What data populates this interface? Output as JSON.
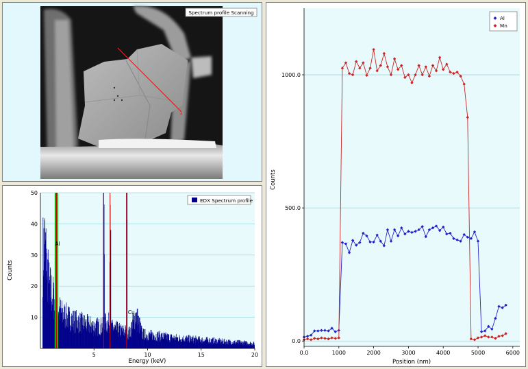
{
  "image_panel": {
    "legend_label": "Spectrum profile Scanning",
    "scan_marker": "1"
  },
  "edx_panel": {
    "legend_label": "EDX Spectrum profile",
    "colors": {
      "bars": "#00008b",
      "plot_bg": "#e8fafc",
      "al_band": "#22cc22",
      "al_line": "#cc0000",
      "mn_line": "#cc0000"
    }
  },
  "profile_panel": {
    "colors": {
      "al": "#2222cc",
      "mn": "#cc2222",
      "plot_bg": "#e8fafc",
      "grid": "#9ad6e0"
    }
  },
  "chart_data": [
    {
      "type": "bar",
      "title": "",
      "xlabel": "Energy (keV)",
      "ylabel": "Counts",
      "xlim": [
        0,
        20
      ],
      "ylim": [
        0,
        50
      ],
      "xticks": [
        5,
        10,
        15,
        20
      ],
      "yticks": [
        10,
        20,
        30,
        40,
        50
      ],
      "grid": true,
      "legend": "top-right",
      "series": [
        {
          "name": "EDX Spectrum profile"
        }
      ],
      "peak_labels": [
        {
          "text": "Al",
          "x": 1.49,
          "y": 33
        },
        {
          "text": "Cu",
          "x": 8.04,
          "y": 11
        }
      ],
      "spectrum_profile": [
        [
          0.2,
          30
        ],
        [
          0.4,
          34
        ],
        [
          0.6,
          26
        ],
        [
          0.8,
          20
        ],
        [
          1.0,
          18
        ],
        [
          1.2,
          16
        ],
        [
          1.4,
          14
        ],
        [
          1.6,
          13
        ],
        [
          1.8,
          12
        ],
        [
          2.0,
          11
        ],
        [
          2.5,
          10
        ],
        [
          3.0,
          9
        ],
        [
          3.5,
          8.5
        ],
        [
          4.0,
          8
        ],
        [
          4.5,
          7.5
        ],
        [
          5.0,
          7
        ],
        [
          5.5,
          7
        ],
        [
          5.9,
          50
        ],
        [
          6.2,
          8
        ],
        [
          6.5,
          50
        ],
        [
          6.8,
          6.5
        ],
        [
          7.2,
          6
        ],
        [
          7.6,
          5.5
        ],
        [
          8.04,
          50
        ],
        [
          8.3,
          5
        ],
        [
          8.9,
          11
        ],
        [
          9.5,
          4.5
        ],
        [
          10,
          4.3
        ],
        [
          11,
          4
        ],
        [
          12,
          3.5
        ],
        [
          13,
          3.2
        ],
        [
          14,
          3
        ],
        [
          15,
          2.7
        ],
        [
          16,
          2.5
        ],
        [
          17,
          2.2
        ],
        [
          18,
          2
        ],
        [
          19,
          1.8
        ],
        [
          20,
          1.5
        ]
      ]
    },
    {
      "type": "line",
      "title": "",
      "xlabel": "Position (nm)",
      "ylabel": "Counts",
      "xlim": [
        0,
        6200
      ],
      "ylim": [
        -20,
        1250
      ],
      "xticks": [
        0,
        1000,
        2000,
        3000,
        4000,
        5000,
        6000
      ],
      "yticks": [
        0,
        500,
        1000
      ],
      "grid": true,
      "legend": "top-right",
      "series": [
        {
          "name": "Al",
          "points": [
            [
              0,
              15
            ],
            [
              100,
              18
            ],
            [
              200,
              22
            ],
            [
              300,
              38
            ],
            [
              400,
              38
            ],
            [
              500,
              40
            ],
            [
              600,
              40
            ],
            [
              700,
              38
            ],
            [
              800,
              48
            ],
            [
              900,
              35
            ],
            [
              1000,
              40
            ],
            [
              1100,
              370
            ],
            [
              1200,
              365
            ],
            [
              1300,
              332
            ],
            [
              1400,
              378
            ],
            [
              1500,
              360
            ],
            [
              1600,
              370
            ],
            [
              1700,
              405
            ],
            [
              1800,
              395
            ],
            [
              1900,
              372
            ],
            [
              2000,
              372
            ],
            [
              2100,
              398
            ],
            [
              2200,
              375
            ],
            [
              2300,
              358
            ],
            [
              2400,
              418
            ],
            [
              2500,
              375
            ],
            [
              2600,
              418
            ],
            [
              2700,
              395
            ],
            [
              2800,
              425
            ],
            [
              2900,
              402
            ],
            [
              3000,
              412
            ],
            [
              3100,
              408
            ],
            [
              3200,
              412
            ],
            [
              3300,
              418
            ],
            [
              3400,
              430
            ],
            [
              3500,
              392
            ],
            [
              3600,
              418
            ],
            [
              3700,
              425
            ],
            [
              3800,
              432
            ],
            [
              3900,
              415
            ],
            [
              4000,
              428
            ],
            [
              4100,
              402
            ],
            [
              4200,
              405
            ],
            [
              4300,
              385
            ],
            [
              4400,
              380
            ],
            [
              4500,
              375
            ],
            [
              4600,
              400
            ],
            [
              4700,
              390
            ],
            [
              4800,
              385
            ],
            [
              4900,
              410
            ],
            [
              5000,
              375
            ],
            [
              5100,
              35
            ],
            [
              5200,
              38
            ],
            [
              5300,
              55
            ],
            [
              5400,
              45
            ],
            [
              5500,
              85
            ],
            [
              5600,
              130
            ],
            [
              5700,
              125
            ],
            [
              5800,
              135
            ]
          ]
        },
        {
          "name": "Mn",
          "points": [
            [
              0,
              5
            ],
            [
              100,
              8
            ],
            [
              200,
              5
            ],
            [
              300,
              10
            ],
            [
              400,
              8
            ],
            [
              500,
              12
            ],
            [
              600,
              10
            ],
            [
              700,
              8
            ],
            [
              800,
              12
            ],
            [
              900,
              10
            ],
            [
              1000,
              12
            ],
            [
              1100,
              1025
            ],
            [
              1200,
              1045
            ],
            [
              1300,
              1005
            ],
            [
              1400,
              1000
            ],
            [
              1500,
              1050
            ],
            [
              1600,
              1025
            ],
            [
              1700,
              1045
            ],
            [
              1800,
              998
            ],
            [
              1900,
              1025
            ],
            [
              2000,
              1095
            ],
            [
              2100,
              1015
            ],
            [
              2200,
              1035
            ],
            [
              2300,
              1080
            ],
            [
              2400,
              1030
            ],
            [
              2500,
              1000
            ],
            [
              2600,
              1060
            ],
            [
              2700,
              1020
            ],
            [
              2800,
              1035
            ],
            [
              2900,
              990
            ],
            [
              3000,
              1000
            ],
            [
              3100,
              970
            ],
            [
              3200,
              1000
            ],
            [
              3300,
              1035
            ],
            [
              3400,
              1000
            ],
            [
              3500,
              1030
            ],
            [
              3600,
              995
            ],
            [
              3700,
              1035
            ],
            [
              3800,
              1015
            ],
            [
              3900,
              1065
            ],
            [
              4000,
              1020
            ],
            [
              4100,
              1040
            ],
            [
              4200,
              1010
            ],
            [
              4300,
              1005
            ],
            [
              4400,
              1010
            ],
            [
              4500,
              995
            ],
            [
              4600,
              965
            ],
            [
              4700,
              840
            ],
            [
              4800,
              8
            ],
            [
              4900,
              5
            ],
            [
              5000,
              12
            ],
            [
              5100,
              15
            ],
            [
              5200,
              20
            ],
            [
              5300,
              15
            ],
            [
              5400,
              15
            ],
            [
              5500,
              10
            ],
            [
              5600,
              18
            ],
            [
              5700,
              20
            ],
            [
              5800,
              28
            ]
          ]
        }
      ]
    }
  ]
}
